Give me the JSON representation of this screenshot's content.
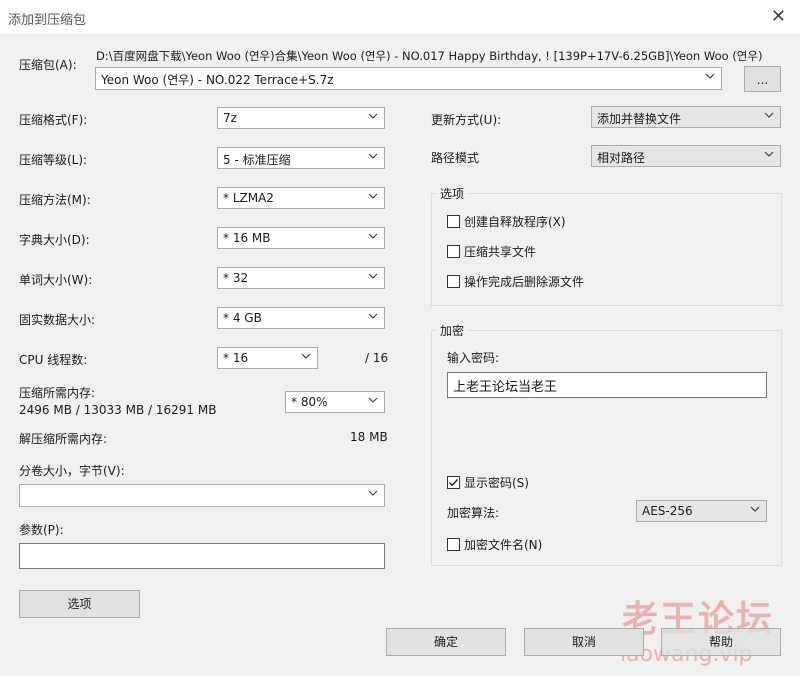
{
  "window": {
    "title": "添加到压缩包",
    "close_glyph": "✕"
  },
  "archive": {
    "label": "压缩包(A):",
    "path_line": "D:\\百度网盘下载\\Yeon Woo (연우)合集\\Yeon Woo (연우) - NO.017 Happy Birthday, ! [139P+17V-6.25GB]\\Yeon Woo (연우)",
    "filename": "Yeon Woo (연우) - NO.022 Terrace+S.7z",
    "browse_label": "..."
  },
  "left": {
    "format": {
      "label": "压缩格式(F):",
      "value": "7z"
    },
    "level": {
      "label": "压缩等级(L):",
      "value": "5 - 标准压缩"
    },
    "method": {
      "label": "压缩方法(M):",
      "value": "* LZMA2"
    },
    "dict": {
      "label": "字典大小(D):",
      "value": "* 16 MB"
    },
    "word": {
      "label": "单词大小(W):",
      "value": "* 32"
    },
    "solid": {
      "label": "固实数据大小:",
      "value": "* 4 GB"
    },
    "threads": {
      "label": "CPU 线程数:",
      "value": "* 16",
      "total": "/ 16"
    },
    "memory": {
      "label": "压缩所需内存:",
      "detail": "2496 MB / 13033 MB / 16291 MB",
      "value": "* 80%"
    },
    "decomp": {
      "label": "解压缩所需内存:",
      "value": "18 MB"
    },
    "volume": {
      "label": "分卷大小，字节(V):",
      "value": ""
    },
    "params": {
      "label": "参数(P):",
      "value": ""
    },
    "options_button": "选项"
  },
  "right": {
    "update": {
      "label": "更新方式(U):",
      "value": "添加并替换文件"
    },
    "pathmode": {
      "label": "路径模式",
      "value": "相对路径"
    },
    "options": {
      "title": "选项",
      "items": [
        {
          "label": "创建自释放程序(X)",
          "checked": false
        },
        {
          "label": "压缩共享文件",
          "checked": false
        },
        {
          "label": "操作完成后删除源文件",
          "checked": false
        }
      ]
    },
    "encryption": {
      "title": "加密",
      "password_label": "输入密码:",
      "password_value": "上老王论坛当老王",
      "show_password": {
        "label": "显示密码(S)",
        "checked": true
      },
      "algo_label": "加密算法:",
      "algo_value": "AES-256",
      "encrypt_names": {
        "label": "加密文件名(N)",
        "checked": false
      }
    }
  },
  "buttons": {
    "ok": "确定",
    "cancel": "取消",
    "help": "帮助"
  },
  "watermark": {
    "text": "老王论坛",
    "url": "laowang.vip"
  }
}
